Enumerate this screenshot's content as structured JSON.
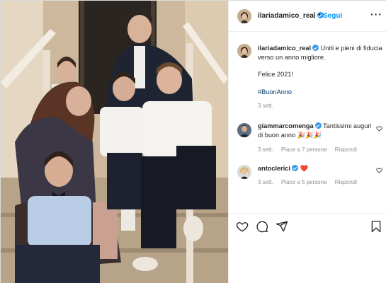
{
  "header": {
    "username": "ilariadamico_real",
    "separator": "•",
    "follow_label": "Segui",
    "more_icon": "more-options-icon"
  },
  "caption": {
    "username": "ilariadamico_real",
    "text_line1": "Uniti e pieni di fiducia verso un anno migliore.",
    "text_line2": "Felice 2021!",
    "hashtag": "#BuonAnno",
    "time": "3 sett."
  },
  "comments": [
    {
      "username": "giammarcomenga",
      "text": "Tantissimi auguri di buon anno",
      "emoji": "🎉🎉🎉",
      "time": "3 sett.",
      "likes": "Piace a 7 persone",
      "reply": "Rispondi"
    },
    {
      "username": "antoclerici",
      "text": "",
      "emoji": "❤️",
      "time": "3 sett.",
      "likes": "Piace a 5 persone",
      "reply": "Rispondi"
    }
  ],
  "actions": {
    "like_icon": "heart-icon",
    "comment_icon": "comment-icon",
    "share_icon": "share-icon",
    "save_icon": "bookmark-icon"
  },
  "colors": {
    "link_blue": "#0095f6",
    "hashtag": "#00376b",
    "verified": "#3897f0",
    "muted": "#8e8e8e",
    "heart_red": "#ed4956"
  }
}
